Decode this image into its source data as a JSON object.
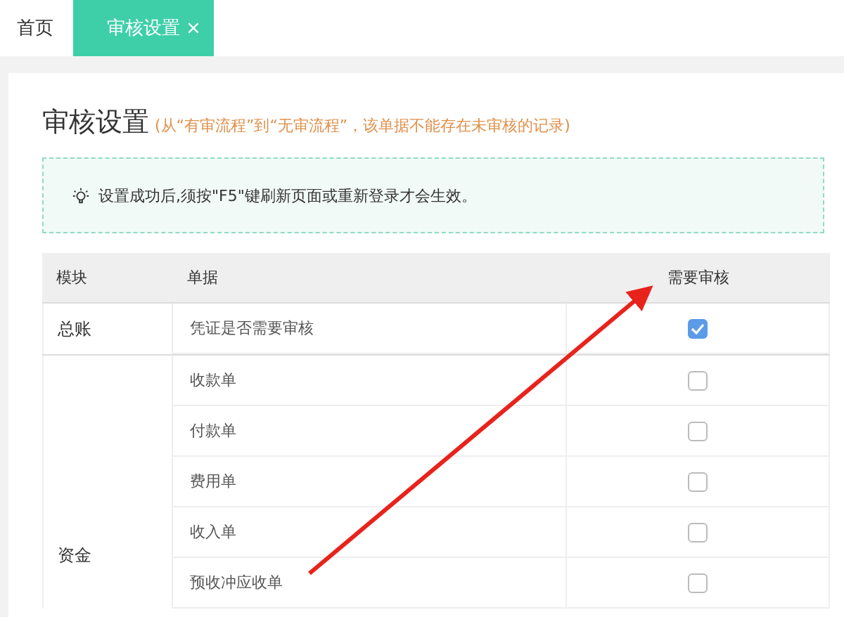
{
  "tabs": [
    {
      "label": "首页",
      "selected": false
    },
    {
      "label": "审核设置",
      "selected": true,
      "close": "×"
    }
  ],
  "title": "审核设置",
  "subtitle": "(从“有审流程”到“无审流程”，该单据不能存在未审核的记录)",
  "tip": "设置成功后,须按\"F5\"键刷新页面或重新登录才会生效。",
  "table": {
    "columns": [
      "模块",
      "单据",
      "需要审核"
    ],
    "groups": [
      {
        "module": "总账",
        "rows": [
          {
            "name": "凭证是否需要审核",
            "checked": true
          }
        ]
      },
      {
        "module": "资金",
        "rows": [
          {
            "name": "收款单",
            "checked": false
          },
          {
            "name": "付款单",
            "checked": false
          },
          {
            "name": "费用单",
            "checked": false
          },
          {
            "name": "收入单",
            "checked": false
          },
          {
            "name": "预收冲应收单",
            "checked": false
          }
        ]
      }
    ]
  }
}
